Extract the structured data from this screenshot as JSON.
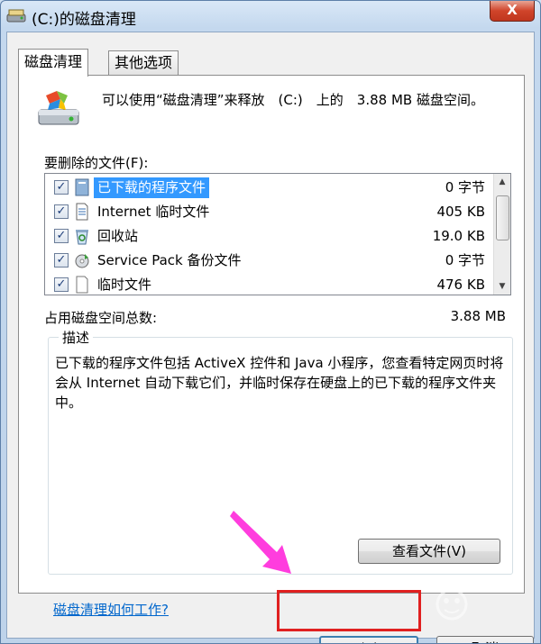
{
  "window": {
    "title": "(C:)的磁盘清理",
    "close_glyph": "X"
  },
  "tabs": [
    {
      "label": "磁盘清理"
    },
    {
      "label": "其他选项"
    }
  ],
  "intro_text": "可以使用“磁盘清理”来释放　(C:)　上的　3.88 MB 磁盘空间。",
  "files_label": "要删除的文件(F):",
  "files": [
    {
      "name": "已下载的程序文件",
      "size": "0 字节",
      "checked": "✓",
      "icon": "program-files-icon"
    },
    {
      "name": "Internet 临时文件",
      "size": "405 KB",
      "checked": "✓",
      "icon": "document-icon"
    },
    {
      "name": "回收站",
      "size": "19.0 KB",
      "checked": "✓",
      "icon": "recycle-bin-icon"
    },
    {
      "name": "Service Pack 备份文件",
      "size": "0 字节",
      "checked": "✓",
      "icon": "backup-icon"
    },
    {
      "name": "临时文件",
      "size": "476 KB",
      "checked": "✓",
      "icon": "blank-file-icon"
    }
  ],
  "total_label": "占用磁盘空间总数:",
  "total_value": "3.88 MB",
  "description": {
    "title": "描述",
    "text": "已下载的程序文件包括 ActiveX 控件和 Java 小程序，您查看特定网页时将会从 Internet 自动下载它们，并临时保存在硬盘上的已下载的程序文件夹中。"
  },
  "view_files_button": "查看文件(V)",
  "help_link": "磁盘清理如何工作?",
  "ok_button": "确定",
  "cancel_button": "取消",
  "annotation_color": "#e02020",
  "arrow_color": "#ff3dde"
}
